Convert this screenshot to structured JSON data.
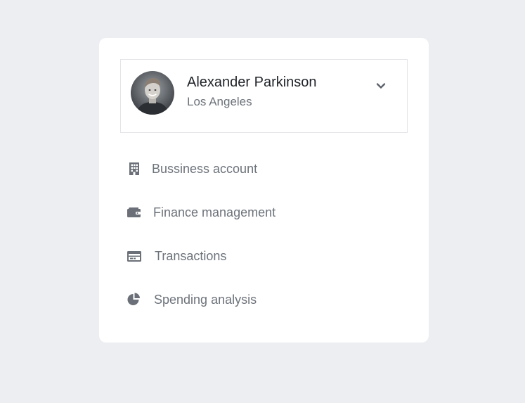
{
  "profile": {
    "name": "Alexander Parkinson",
    "city": "Los Angeles",
    "avatar_icon": "user-avatar",
    "expand_icon": "chevron-down-icon"
  },
  "menu": {
    "items": [
      {
        "label": "Bussiness account",
        "icon": "building-icon"
      },
      {
        "label": "Finance management",
        "icon": "wallet-icon"
      },
      {
        "label": "Transactions",
        "icon": "credit-card-icon"
      },
      {
        "label": "Spending analysis",
        "icon": "pie-chart-icon"
      }
    ]
  },
  "colors": {
    "page_background": "#edeef1",
    "card_background": "#ffffff",
    "text_primary": "#1f2328",
    "text_secondary": "#6d737b",
    "border": "#e2e4e8"
  }
}
